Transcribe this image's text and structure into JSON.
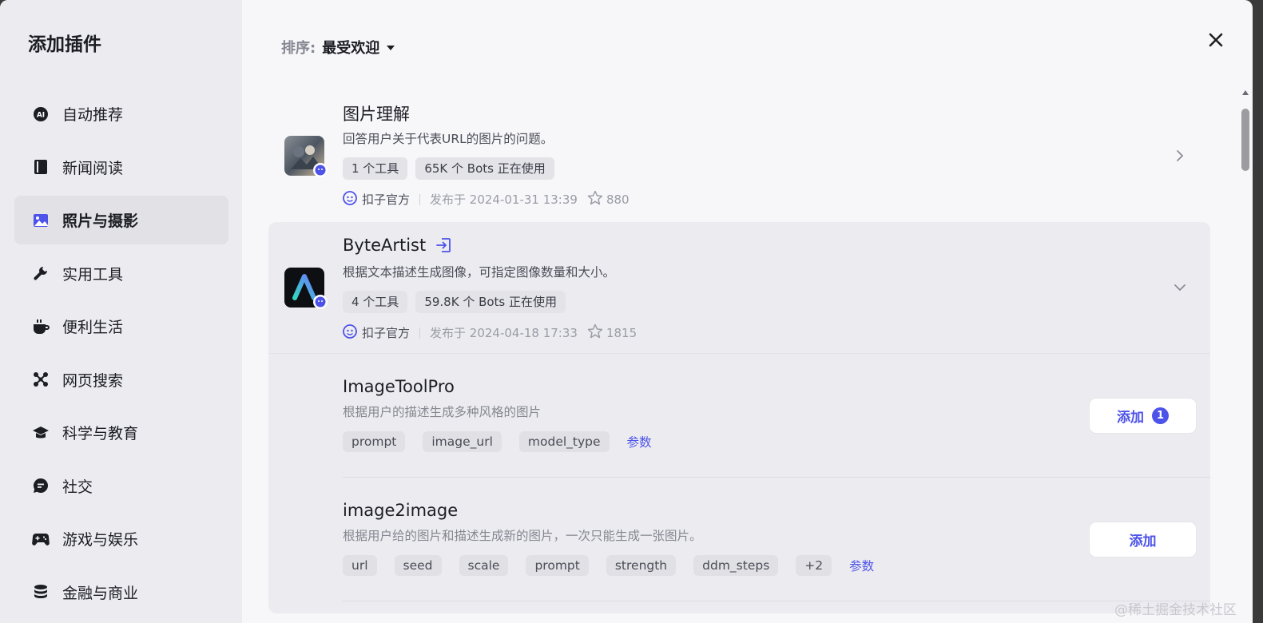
{
  "sidebar": {
    "title": "添加插件",
    "items": [
      {
        "label": "自动推荐",
        "icon": "ai-icon"
      },
      {
        "label": "新闻阅读",
        "icon": "book-icon"
      },
      {
        "label": "照片与摄影",
        "icon": "image-icon",
        "active": true
      },
      {
        "label": "实用工具",
        "icon": "wrench-icon"
      },
      {
        "label": "便利生活",
        "icon": "coffee-icon"
      },
      {
        "label": "网页搜索",
        "icon": "network-icon"
      },
      {
        "label": "科学与教育",
        "icon": "graduation-cap-icon"
      },
      {
        "label": "社交",
        "icon": "chat-icon"
      },
      {
        "label": "游戏与娱乐",
        "icon": "gamepad-icon"
      },
      {
        "label": "金融与商业",
        "icon": "coins-icon"
      }
    ]
  },
  "sort": {
    "label": "排序:",
    "value": "最受欢迎"
  },
  "plugins": [
    {
      "title": "图片理解",
      "desc": "回答用户关于代表URL的图片的问题。",
      "tags": [
        "1 个工具",
        "65K 个 Bots 正在使用"
      ],
      "author": "扣子官方",
      "published": "发布于 2024-01-31 13:39",
      "stars": "880"
    },
    {
      "title": "ByteArtist",
      "desc": "根据文本描述生成图像，可指定图像数量和大小。",
      "tags": [
        "4 个工具",
        "59.8K 个 Bots 正在使用"
      ],
      "author": "扣子官方",
      "published": "发布于 2024-04-18 17:33",
      "stars": "1815",
      "tools": [
        {
          "name": "ImageToolPro",
          "desc": "根据用户的描述生成多种风格的图片",
          "params": [
            "prompt",
            "image_url",
            "model_type"
          ],
          "params_link": "参数",
          "add_label": "添加",
          "add_count": "1"
        },
        {
          "name": "image2image",
          "desc": "根据用户给的图片和描述生成新的图片，一次只能生成一张图片。",
          "params": [
            "url",
            "seed",
            "scale",
            "prompt",
            "strength",
            "ddm_steps",
            "+2"
          ],
          "params_link": "参数",
          "add_label": "添加"
        }
      ]
    }
  ],
  "watermark": "@稀土掘金技术社区",
  "colors": {
    "accent": "#4d53e8",
    "sidebar_bg": "#ececf0",
    "main_bg": "#f7f7fa"
  }
}
